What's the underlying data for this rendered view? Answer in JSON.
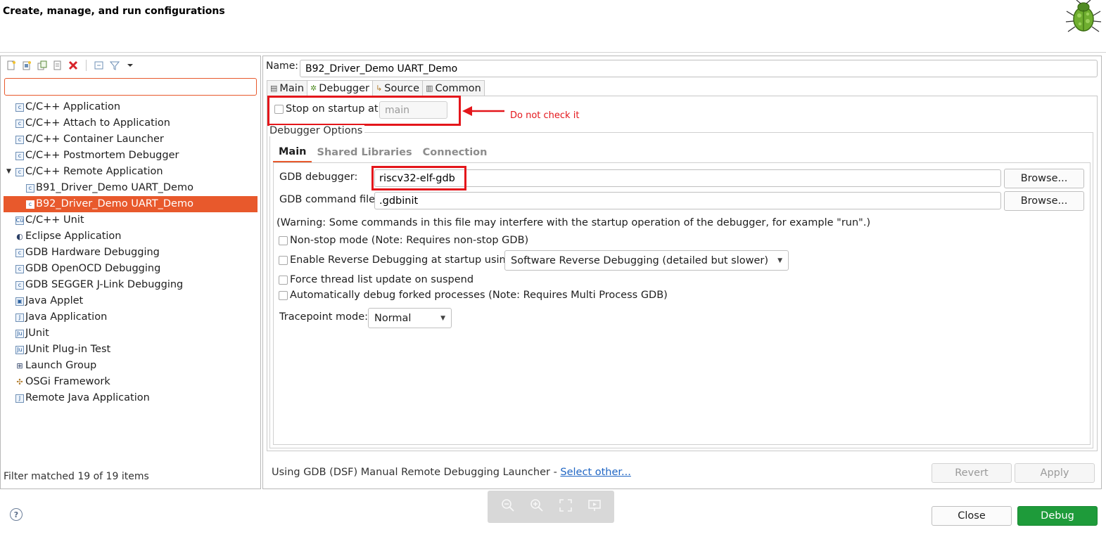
{
  "header": {
    "title": "Create, manage, and run configurations",
    "logo_icon": "bug-icon"
  },
  "left_panel": {
    "toolbar_icons": [
      "new-config-icon",
      "new-prototype-icon",
      "duplicate-icon",
      "export-icon",
      "delete-icon",
      "collapse-all-icon",
      "filter-icon",
      "dropdown-icon"
    ],
    "filter_value": "",
    "tree": [
      {
        "label": "C/C++ Application",
        "icon": "c",
        "indent": 0
      },
      {
        "label": "C/C++ Attach to Application",
        "icon": "c",
        "indent": 0
      },
      {
        "label": "C/C++ Container Launcher",
        "icon": "c",
        "indent": 0
      },
      {
        "label": "C/C++ Postmortem Debugger",
        "icon": "c",
        "indent": 0
      },
      {
        "label": "C/C++ Remote Application",
        "icon": "c",
        "indent": 0,
        "expanded": true
      },
      {
        "label": "B91_Driver_Demo UART_Demo",
        "icon": "c",
        "indent": 1
      },
      {
        "label": "B92_Driver_Demo UART_Demo",
        "icon": "c",
        "indent": 1,
        "selected": true
      },
      {
        "label": "C/C++ Unit",
        "icon": "cu",
        "indent": 0
      },
      {
        "label": "Eclipse Application",
        "icon": "eclipse",
        "indent": 0
      },
      {
        "label": "GDB Hardware Debugging",
        "icon": "c",
        "indent": 0
      },
      {
        "label": "GDB OpenOCD Debugging",
        "icon": "c",
        "indent": 0
      },
      {
        "label": "GDB SEGGER J-Link Debugging",
        "icon": "c",
        "indent": 0
      },
      {
        "label": "Java Applet",
        "icon": "applet",
        "indent": 0
      },
      {
        "label": "Java Application",
        "icon": "j",
        "indent": 0
      },
      {
        "label": "JUnit",
        "icon": "ju",
        "indent": 0
      },
      {
        "label": "JUnit Plug-in Test",
        "icon": "ju",
        "indent": 0
      },
      {
        "label": "Launch Group",
        "icon": "group",
        "indent": 0
      },
      {
        "label": "OSGi Framework",
        "icon": "osgi",
        "indent": 0
      },
      {
        "label": "Remote Java Application",
        "icon": "remote",
        "indent": 0
      }
    ],
    "filter_status": "Filter matched 19 of 19 items"
  },
  "config": {
    "name_label": "Name:",
    "name_value": "B92_Driver_Demo UART_Demo",
    "tabs": [
      {
        "label": "Main",
        "icon": "main-tab-icon"
      },
      {
        "label": "Debugger",
        "icon": "debugger-tab-icon",
        "active": true
      },
      {
        "label": "Source",
        "icon": "source-tab-icon"
      },
      {
        "label": "Common",
        "icon": "common-tab-icon"
      }
    ],
    "stop_on_startup_label": "Stop on startup at:",
    "stop_on_startup_value": "main",
    "annotation": "Do not check it",
    "debugger_options_label": "Debugger Options",
    "inner_tabs": [
      "Main",
      "Shared Libraries",
      "Connection"
    ],
    "gdb_debugger_label": "GDB debugger:",
    "gdb_debugger_value": "riscv32-elf-gdb",
    "gdb_command_file_label": "GDB command file:",
    "gdb_command_file_value": ".gdbinit",
    "browse_label": "Browse...",
    "warning_text": "(Warning: Some commands in this file may interfere with the startup operation of the debugger, for example \"run\".)",
    "non_stop_label": "Non-stop mode (Note: Requires non-stop GDB)",
    "reverse_label": "Enable Reverse Debugging at startup using:",
    "reverse_option": "Software Reverse Debugging (detailed but slower)",
    "force_thread_label": "Force thread list update on suspend",
    "auto_fork_label": "Automatically debug forked processes (Note: Requires Multi Process GDB)",
    "tracepoint_label": "Tracepoint mode:",
    "tracepoint_value": "Normal",
    "launcher_text": "Using GDB (DSF) Manual Remote Debugging Launcher - ",
    "launcher_link": "Select other...",
    "revert_label": "Revert",
    "apply_label": "Apply"
  },
  "footer": {
    "help_icon": "help-icon",
    "close_label": "Close",
    "debug_label": "Debug",
    "viewer_icons": [
      "zoom-out-icon",
      "zoom-in-icon",
      "fullscreen-icon",
      "slideshow-icon"
    ]
  },
  "colors": {
    "selection": "#e8592c",
    "annotation_red": "#e4161b",
    "debug_button": "#1e9b3a",
    "link": "#2066c4"
  }
}
